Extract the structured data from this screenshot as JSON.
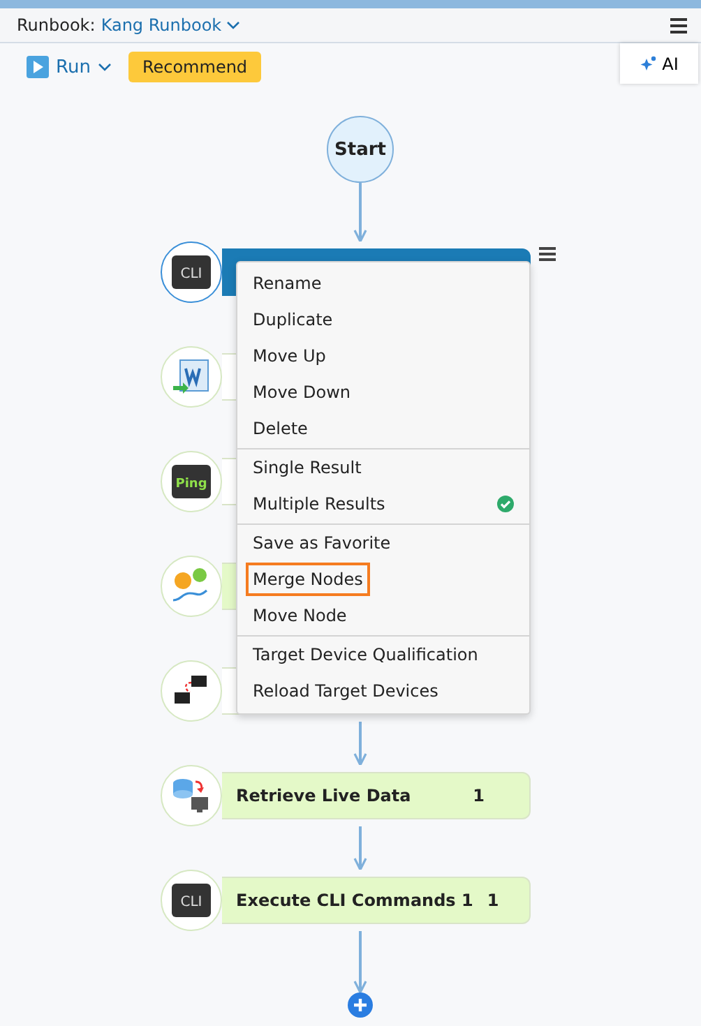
{
  "header": {
    "label": "Runbook:",
    "runbook": "Kang Runbook"
  },
  "toolbar": {
    "run": "Run",
    "recommend": "Recommend",
    "ai": "AI"
  },
  "start": "Start",
  "nodes": [
    {
      "kind": "cli",
      "icon_text": "CLI",
      "selected": true,
      "color": "#1b7bb5"
    },
    {
      "kind": "word",
      "selected": false,
      "color": "#ffffff"
    },
    {
      "kind": "ping",
      "icon_text": "Ping",
      "selected": false,
      "color": "#ffffff"
    },
    {
      "kind": "path",
      "selected": false,
      "color": "#e4f9c8"
    },
    {
      "kind": "topology",
      "selected": false,
      "color": "#ffffff"
    },
    {
      "kind": "live",
      "selected": false,
      "color": "#e4f9c8",
      "label": "Retrieve Live Data",
      "count": "1"
    },
    {
      "kind": "cli",
      "icon_text": "CLI",
      "selected": false,
      "color": "#e4f9c8",
      "label": "Execute CLI Commands 1",
      "count": "1"
    }
  ],
  "menu": {
    "groups": [
      [
        {
          "label": "Rename",
          "checked": false,
          "highlighted": false
        },
        {
          "label": "Duplicate",
          "checked": false,
          "highlighted": false
        },
        {
          "label": "Move Up",
          "checked": false,
          "highlighted": false
        },
        {
          "label": "Move Down",
          "checked": false,
          "highlighted": false
        },
        {
          "label": "Delete",
          "checked": false,
          "highlighted": false
        }
      ],
      [
        {
          "label": "Single Result",
          "checked": false,
          "highlighted": false
        },
        {
          "label": "Multiple Results",
          "checked": true,
          "highlighted": false
        }
      ],
      [
        {
          "label": "Save as Favorite",
          "checked": false,
          "highlighted": false
        },
        {
          "label": "Merge Nodes",
          "checked": false,
          "highlighted": true
        },
        {
          "label": "Move Node",
          "checked": false,
          "highlighted": false
        }
      ],
      [
        {
          "label": "Target Device Qualification",
          "checked": false,
          "highlighted": false
        },
        {
          "label": "Reload Target Devices",
          "checked": false,
          "highlighted": false
        }
      ]
    ]
  }
}
